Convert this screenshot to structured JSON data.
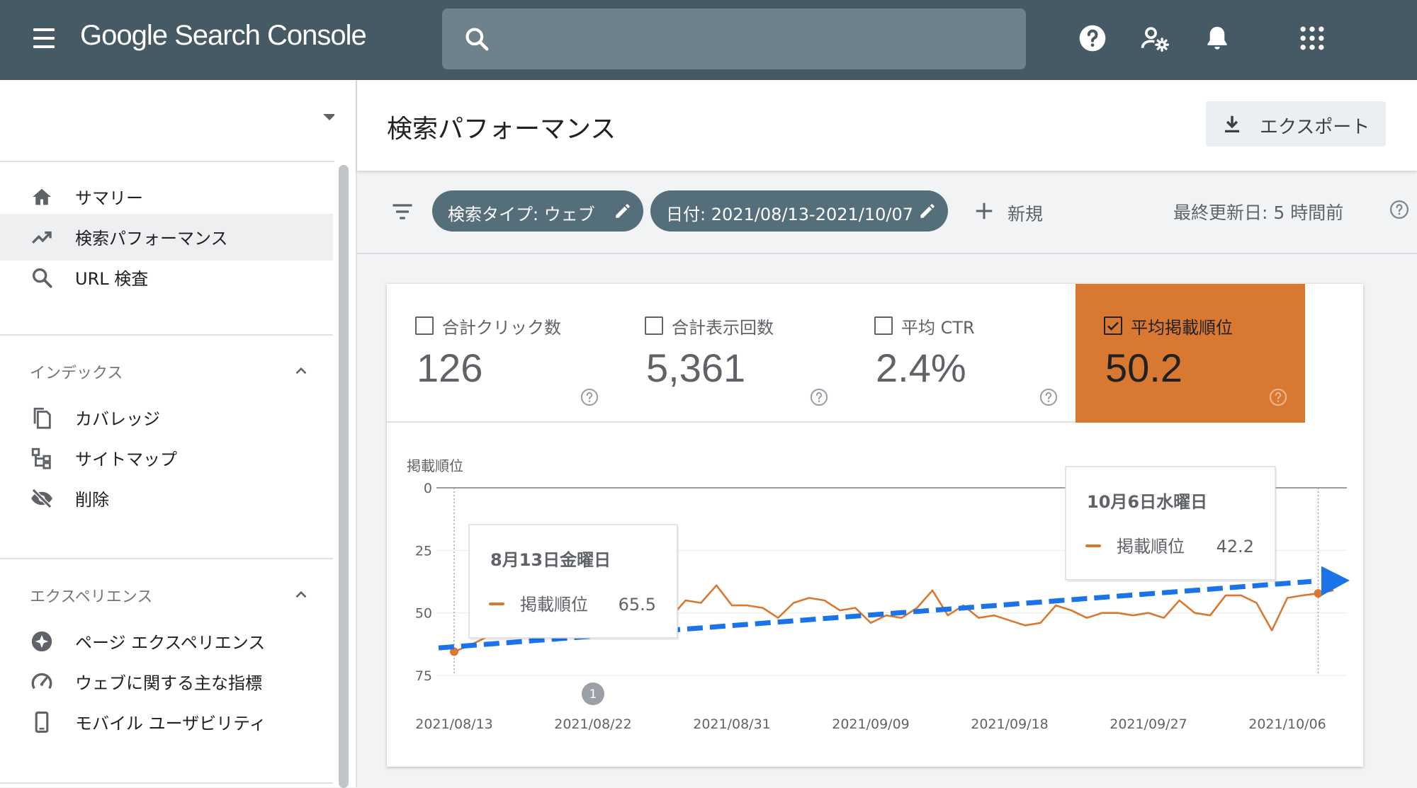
{
  "app": {
    "logo": "Google Search Console"
  },
  "search": {
    "placeholder": ""
  },
  "sidebar": {
    "items_top": [
      {
        "label": "サマリー",
        "icon": "home-icon"
      },
      {
        "label": "検索パフォーマンス",
        "icon": "trending-up-icon",
        "active": true
      },
      {
        "label": "URL 検査",
        "icon": "search-icon"
      }
    ],
    "sections": [
      {
        "title": "インデックス",
        "items": [
          {
            "label": "カバレッジ",
            "icon": "copy-icon"
          },
          {
            "label": "サイトマップ",
            "icon": "sitemap-icon"
          },
          {
            "label": "削除",
            "icon": "visibility-off-icon"
          }
        ]
      },
      {
        "title": "エクスペリエンス",
        "items": [
          {
            "label": "ページ エクスペリエンス",
            "icon": "star-badge-icon"
          },
          {
            "label": "ウェブに関する主な指標",
            "icon": "speed-icon"
          },
          {
            "label": "モバイル ユーザビリティ",
            "icon": "phone-icon"
          }
        ]
      }
    ]
  },
  "header": {
    "title": "検索パフォーマンス",
    "export_label": "エクスポート"
  },
  "filters": {
    "chip_search_type": "検索タイプ: ウェブ",
    "chip_date": "日付: 2021/08/13-2021/10/07",
    "new_label": "新規",
    "last_updated": "最終更新日: 5 時間前"
  },
  "metrics": [
    {
      "label": "合計クリック数",
      "value": "126",
      "selected": false
    },
    {
      "label": "合計表示回数",
      "value": "5,361",
      "selected": false
    },
    {
      "label": "平均 CTR",
      "value": "2.4%",
      "selected": false
    },
    {
      "label": "平均掲載順位",
      "value": "50.2",
      "selected": true
    }
  ],
  "colors": {
    "accent": "#d97831",
    "topbar": "#455a64",
    "trend_arrow": "#1a73e8"
  },
  "chart_data": {
    "type": "line",
    "ylabel": "掲載順位",
    "y_inverted": true,
    "ylim": [
      0,
      75
    ],
    "yticks": [
      "0",
      "25",
      "50",
      "75"
    ],
    "x_ticks": [
      "2021/08/13",
      "2021/08/22",
      "2021/08/31",
      "2021/09/09",
      "2021/09/18",
      "2021/09/27",
      "2021/10/06"
    ],
    "x_start": "2021/08/13",
    "series": [
      {
        "name": "掲載順位",
        "color": "#d97831",
        "values": [
          65.5,
          63,
          60,
          57,
          54,
          55,
          52,
          48,
          50,
          49,
          51,
          47,
          49,
          53,
          52,
          45,
          46,
          39,
          47,
          47,
          48,
          52,
          46,
          44,
          45,
          49,
          48,
          54,
          51,
          52,
          48,
          41,
          51,
          47,
          52,
          51,
          53,
          55,
          54,
          47,
          49,
          52,
          50,
          50,
          51,
          50,
          52,
          45,
          50,
          51,
          43,
          43,
          46,
          57,
          44,
          43,
          42.2,
          41
        ]
      }
    ],
    "annotation_marker": "1",
    "tooltips": [
      {
        "date": "8月13日金曜日",
        "series": "掲載順位",
        "value": "65.5"
      },
      {
        "date": "10月6日水曜日",
        "series": "掲載順位",
        "value": "42.2"
      }
    ],
    "trend_arrow": {
      "from": 64,
      "to": 37
    }
  }
}
